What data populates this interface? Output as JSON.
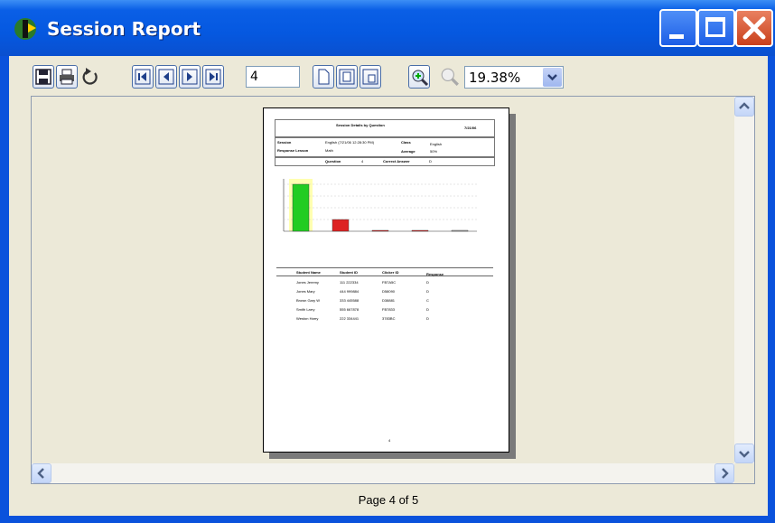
{
  "window": {
    "title": "Session Report"
  },
  "toolbar": {
    "page_number": "4",
    "zoom_value": "19.38%"
  },
  "report": {
    "heading": "Session Details by Question",
    "date": "7/21/06",
    "session_label": "Session",
    "session_value": "English (7/21/06 12:28:30 PM)",
    "class_label": "Class",
    "class_value": "English",
    "lesson_label": "Response Lesson",
    "lesson_value": "Math",
    "average_label": "Average",
    "average_value": "50%",
    "question_label": "Question",
    "question_value": "4",
    "correct_label": "Correct Answer",
    "correct_value": "D",
    "page_footer": "4",
    "table_headers": [
      "Student Name",
      "Student ID",
      "Clicker ID",
      "Response"
    ],
    "rows": [
      [
        "Jones Jeremy",
        "111 222334",
        "FB7A5C",
        "D"
      ],
      [
        "Jones Mary",
        "444 999884",
        "D58090",
        "D"
      ],
      [
        "Brown Gary W",
        "333 445588",
        "D38881",
        "C"
      ],
      [
        "Smith Larry",
        "555 667878",
        "FB7833",
        "D"
      ],
      [
        "Weston Harry",
        "222 334441",
        "3783BC",
        "D"
      ]
    ]
  },
  "chart_data": {
    "type": "bar",
    "values": [
      4,
      1,
      0,
      0,
      0
    ],
    "colors": [
      "#22cc22",
      "#dd2222",
      "#dd2222",
      "#dd2222",
      "#aaaaaa"
    ]
  },
  "status": {
    "page_text": "Page 4 of 5"
  }
}
